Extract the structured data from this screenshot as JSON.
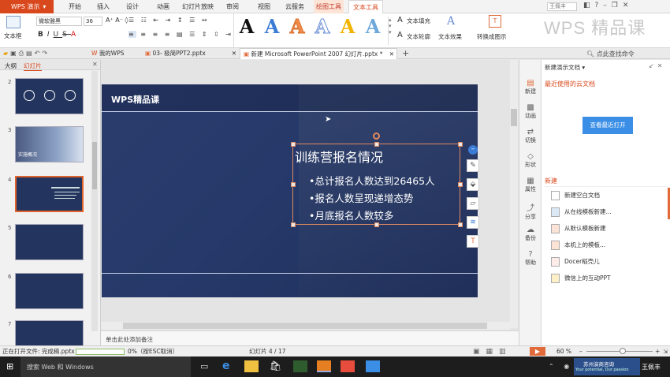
{
  "app": {
    "name": "WPS 演示",
    "window_user": "王佩丰",
    "brand_logo": "WPS 精品课"
  },
  "menu": {
    "items": [
      "开始",
      "插入",
      "设计",
      "动画",
      "幻灯片放映",
      "审阅",
      "视图",
      "云服务",
      "绘图工具",
      "文本工具"
    ],
    "active": "文本工具"
  },
  "ribbon": {
    "textbox_label": "文本框",
    "font_name": "微软雅黑",
    "font_size": "36",
    "wordart_letters": [
      "A",
      "A",
      "A",
      "A",
      "A",
      "A"
    ],
    "wordart_colors": [
      "#111111",
      "#3a7bd5",
      "#f28b4a",
      "#9ab3d9",
      "#f2b400",
      "#6fa8dc"
    ],
    "text_fill": "文本填充",
    "text_outline": "文本轮廓",
    "text_effect": "文本效果",
    "convert_graphic": "转换成图示",
    "bold": "B",
    "italic": "I",
    "underline": "U",
    "strike": "S"
  },
  "tabs": [
    {
      "label": "我的WPS"
    },
    {
      "label": "03- 极简PPT2.pptx"
    },
    {
      "label": "新建 Microsoft PowerPoint 2007 幻灯片.pptx *"
    }
  ],
  "toolbar_right": {
    "search": "点此查找命令"
  },
  "left_pane": {
    "tabs": [
      "大纲",
      "幻灯片"
    ],
    "slide_numbers": [
      "2",
      "3",
      "4",
      "5",
      "6",
      "7"
    ],
    "thumb3_label": "实施概况",
    "add_button": "+"
  },
  "slide": {
    "header": "WPS精品课",
    "title": "训练营报名情况",
    "bullets": [
      "•总计报名人数达到26465人",
      "•报名人数呈现递增态势",
      "•月底报名人数较多"
    ]
  },
  "notes_placeholder": "单击此处添加备注",
  "side_nav": [
    {
      "icon": "new-icon",
      "label": "新建"
    },
    {
      "icon": "animation-icon",
      "label": "动画"
    },
    {
      "icon": "switch-icon",
      "label": "切换"
    },
    {
      "icon": "shape-icon",
      "label": "形状"
    },
    {
      "icon": "properties-icon",
      "label": "属性"
    },
    {
      "icon": "share-icon",
      "label": "分享"
    },
    {
      "icon": "backup-icon",
      "label": "备份"
    },
    {
      "icon": "help-icon",
      "label": "帮助"
    }
  ],
  "right_pane": {
    "header": "新建演示文档",
    "recent_title": "最近使用的云文档",
    "view_recent_button": "查看最近打开",
    "new_section": "新建",
    "items": [
      "新建空白文档",
      "从在线模板新建...",
      "从默认模板新建",
      "本机上的模板...",
      "Docer稻壳儿",
      "微信上的互动PPT"
    ]
  },
  "status": {
    "opening": "正在打开文件: 完成稿.pptx",
    "progress_percent": 0,
    "progress_text": "0%（按ESC取消）",
    "slide_counter": "幻灯片 4 / 17",
    "zoom": "60 %",
    "zoom_level": 0.55
  },
  "taskbar": {
    "search": "搜索 Web 和 Windows",
    "tray_text1": "苏州演商咨询",
    "tray_text2": "Your potential, Our passion",
    "user": "王佩丰"
  }
}
